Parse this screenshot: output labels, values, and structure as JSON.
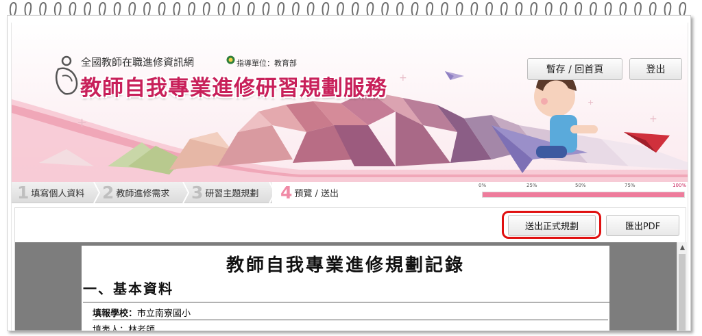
{
  "header": {
    "org_title": "全國教師在職進修資訊網",
    "guide_text": "指導單位：教育部",
    "service_title": "教師自我專業進修研習規劃服務",
    "save_home_label": "暫存 / 回首頁",
    "logout_label": "登出"
  },
  "steps": [
    {
      "num": "1",
      "label": "填寫個人資料"
    },
    {
      "num": "2",
      "label": "教師進修需求"
    },
    {
      "num": "3",
      "label": "研習主題規劃"
    },
    {
      "num": "4",
      "label": "預覽 / 送出"
    }
  ],
  "progress": {
    "labels": [
      "0%",
      "25%",
      "50%",
      "75%",
      "100%"
    ],
    "value_percent": 100
  },
  "actions": {
    "submit_label": "送出正式規劃",
    "pdf_label": "匯出PDF"
  },
  "document": {
    "title": "教師自我專業進修規劃記錄",
    "section_title": "一、基本資料",
    "school_label": "填報學校：",
    "school_value": "市立南寮國小",
    "next_row": "填表人：林老師"
  },
  "icons": {
    "logo": "person-book-icon",
    "guide": "ministry-emblem-icon",
    "scroll_up": "chevron-up-icon"
  },
  "colors": {
    "accent_pink": "#c8205a",
    "progress_fill": "#ee7c9c",
    "highlight_ring": "#e01010"
  }
}
